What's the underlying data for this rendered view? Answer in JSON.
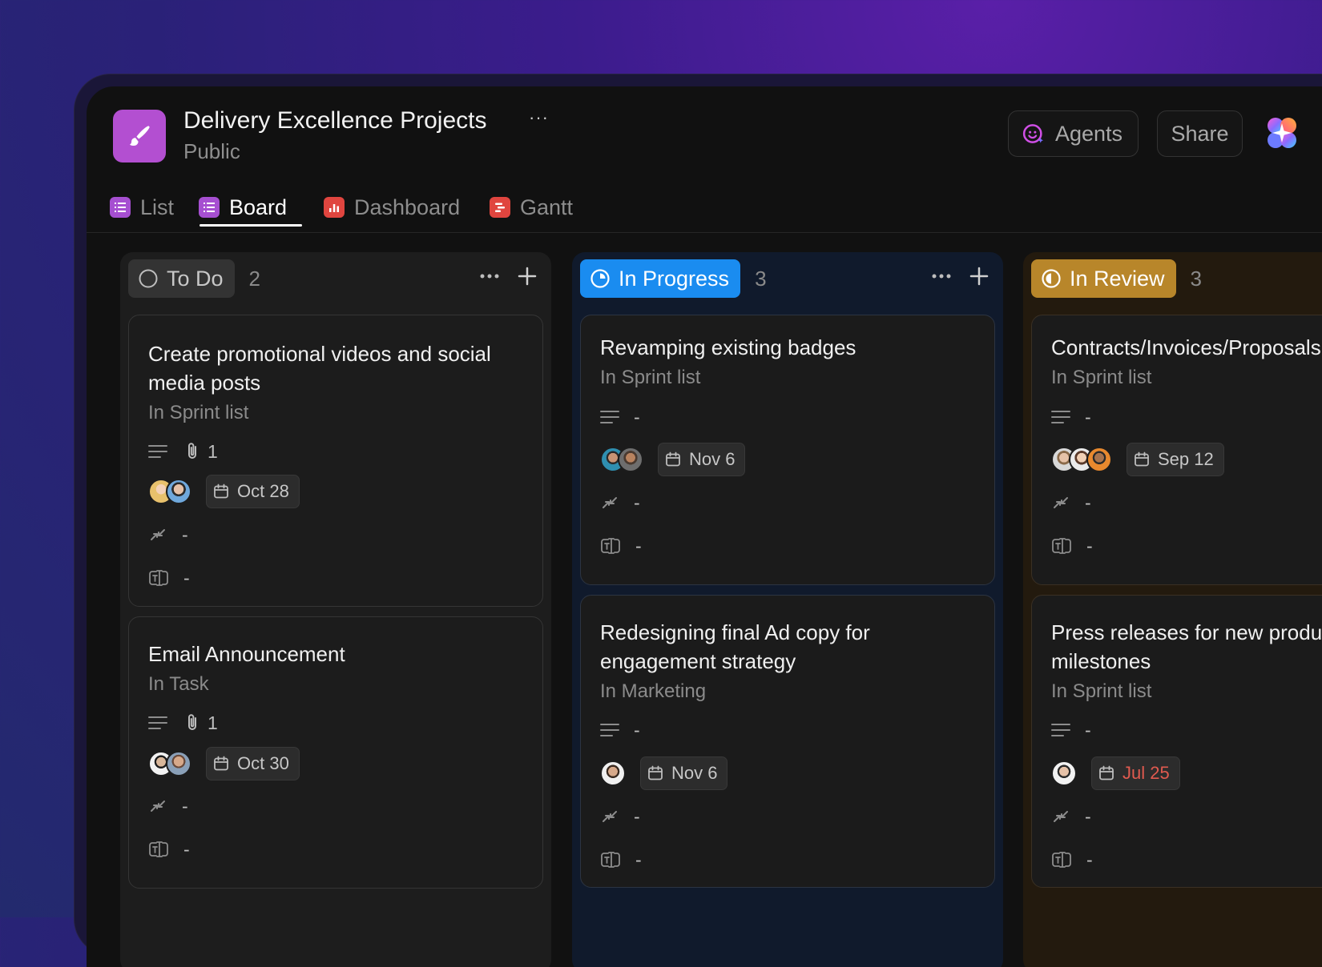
{
  "project": {
    "title": "Delivery Excellence Projects",
    "more": "···",
    "visibility": "Public"
  },
  "header": {
    "agents_label": "Agents",
    "share_label": "Share"
  },
  "tabs": [
    {
      "label": "List",
      "icon": "list-icon",
      "color": "#a64fd1"
    },
    {
      "label": "Board",
      "icon": "board-icon",
      "color": "#a64fd1",
      "active": true
    },
    {
      "label": "Dashboard",
      "icon": "dashboard-icon",
      "color": "#e0453f"
    },
    {
      "label": "Gantt",
      "icon": "gantt-icon",
      "color": "#e0453f"
    }
  ],
  "columns": [
    {
      "name": "To Do",
      "count": "2",
      "color": "#333333",
      "cards": [
        {
          "title": "Create promotional videos and social media posts",
          "location": "In Sprint list",
          "attachments": "1",
          "date": "Oct 28",
          "priority": "-",
          "custom": "-"
        },
        {
          "title": "Email Announcement",
          "location": "In Task",
          "attachments": "1",
          "date": "Oct 30",
          "priority": "-",
          "custom": "-"
        }
      ]
    },
    {
      "name": "In Progress",
      "count": "3",
      "color": "#1a8cf0",
      "cards": [
        {
          "title": "Revamping existing badges",
          "location": "In Sprint list",
          "description": "-",
          "date": "Nov 6",
          "priority": "-",
          "custom": "-"
        },
        {
          "title": "Redesigning final Ad copy for engagement strategy",
          "location": "In Marketing",
          "description": "-",
          "date": "Nov 6",
          "priority": "-",
          "custom": "-"
        }
      ]
    },
    {
      "name": "In Review",
      "count": "3",
      "color": "#b8862a",
      "cards": [
        {
          "title": "Contracts/Invoices/Proposals",
          "location": "In Sprint list",
          "description": "-",
          "date": "Sep 12",
          "priority": "-",
          "custom": "-"
        },
        {
          "title": "Press releases for new product features or milestones",
          "location": "In Sprint list",
          "description": "-",
          "date": "Jul 25",
          "date_overdue": true,
          "priority": "-",
          "custom": "-"
        }
      ]
    }
  ]
}
